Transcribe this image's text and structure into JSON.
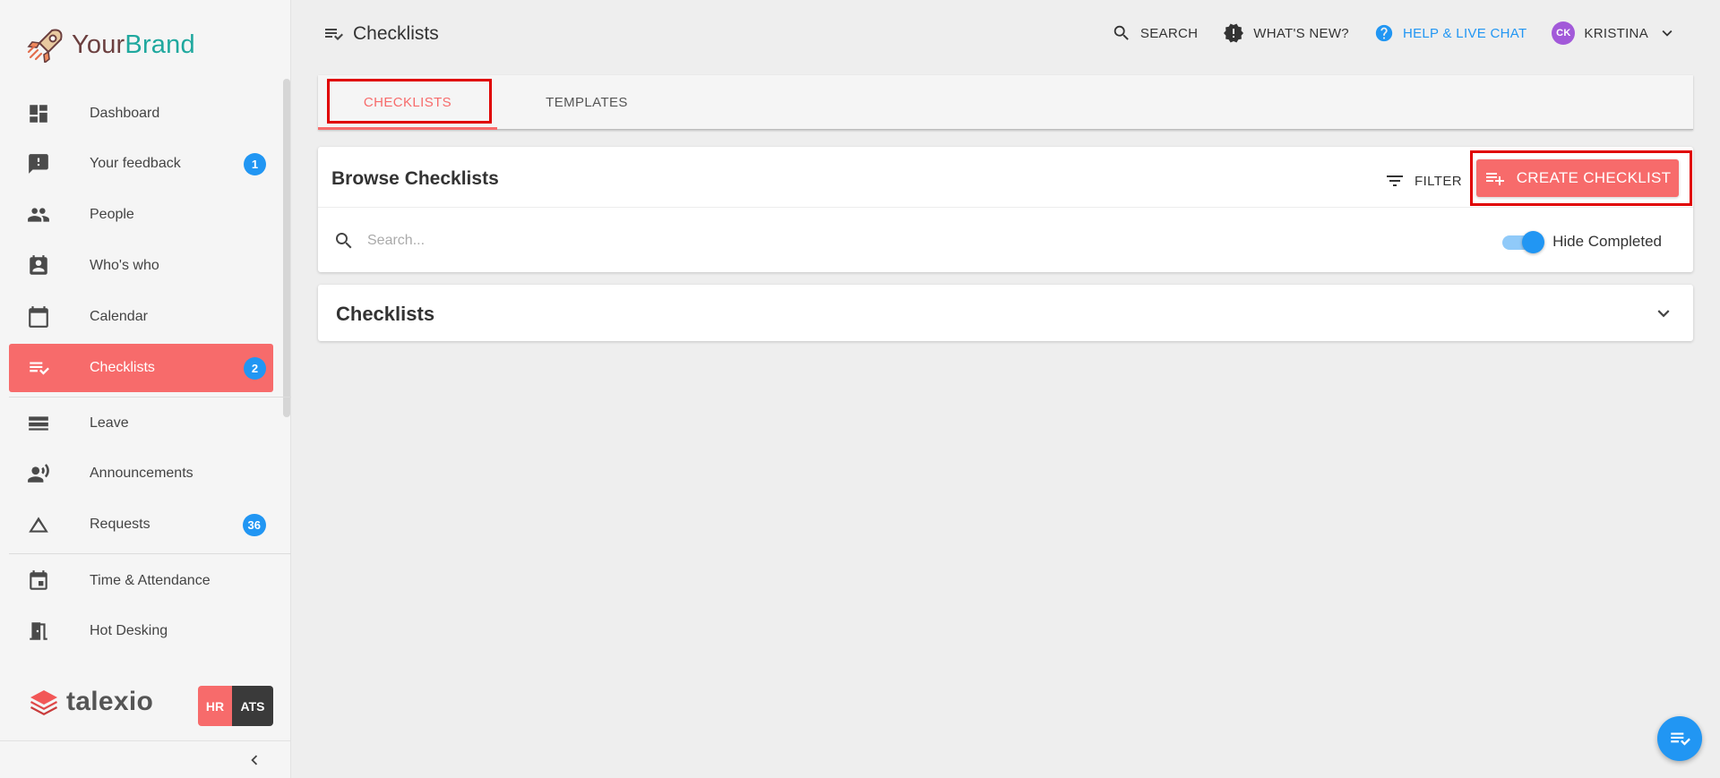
{
  "brand": {
    "name_part1": "Your",
    "name_part2": "Brand"
  },
  "sidebar": {
    "items": [
      {
        "label": "Dashboard",
        "icon": "dashboard-icon"
      },
      {
        "label": "Your feedback",
        "icon": "feedback-icon",
        "badge": "1"
      },
      {
        "label": "People",
        "icon": "people-icon"
      },
      {
        "label": "Who's who",
        "icon": "contact-card-icon"
      },
      {
        "label": "Calendar",
        "icon": "calendar-icon"
      },
      {
        "label": "Checklists",
        "icon": "checklist-icon",
        "badge": "2",
        "active": true
      },
      {
        "label": "Leave",
        "icon": "leave-icon"
      },
      {
        "label": "Announcements",
        "icon": "announcement-icon"
      },
      {
        "label": "Requests",
        "icon": "triangle-icon",
        "badge": "36"
      },
      {
        "label": "Time & Attendance",
        "icon": "event-icon"
      },
      {
        "label": "Hot Desking",
        "icon": "door-icon"
      }
    ],
    "footer_brand": "talexio",
    "hr_label": "HR",
    "ats_label": "ATS"
  },
  "header": {
    "title": "Checklists",
    "search_label": "SEARCH",
    "whats_new_label": "WHAT'S NEW?",
    "help_label": "HELP & LIVE CHAT",
    "user_initials": "CK",
    "user_name": "KRISTINA"
  },
  "tabs": [
    {
      "label": "CHECKLISTS",
      "active": true
    },
    {
      "label": "TEMPLATES",
      "active": false
    }
  ],
  "browse": {
    "title": "Browse Checklists",
    "filter_label": "FILTER",
    "create_label": "CREATE CHECKLIST",
    "search_placeholder": "Search...",
    "search_value": "",
    "hide_completed_label": "Hide Completed",
    "hide_completed_on": true
  },
  "checklists_panel": {
    "title": "Checklists"
  },
  "colors": {
    "accent": "#f76b6b",
    "primary": "#2196f3",
    "highlight": "#e00000"
  }
}
